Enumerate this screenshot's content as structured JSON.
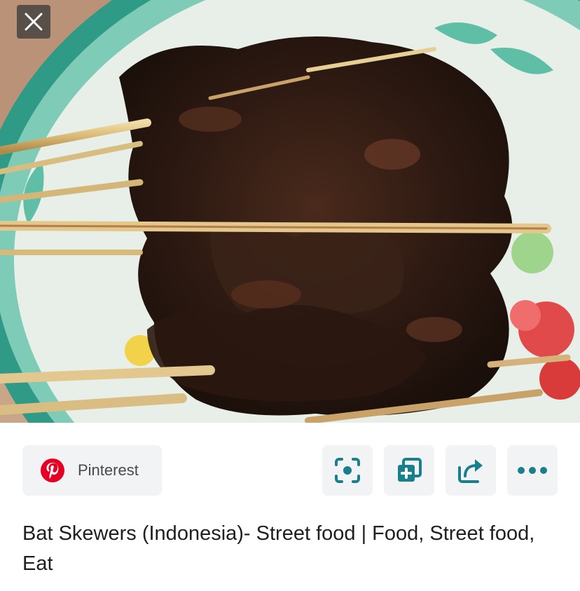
{
  "viewer": {
    "close_icon": "close-icon"
  },
  "action_bar": {
    "source": {
      "name": "Pinterest",
      "icon": "pinterest-logo-icon",
      "brand_color": "#e60023"
    },
    "buttons": [
      {
        "name": "lens-button",
        "icon": "lens-scan-icon"
      },
      {
        "name": "save-to-collection-button",
        "icon": "add-to-collection-icon"
      },
      {
        "name": "share-button",
        "icon": "share-arrow-icon"
      },
      {
        "name": "more-options-button",
        "icon": "more-dots-icon"
      }
    ],
    "accent_color": "#1a7f8c"
  },
  "result": {
    "title": "Bat Skewers (Indonesia)- Street food | Food, Street food, Eat"
  }
}
